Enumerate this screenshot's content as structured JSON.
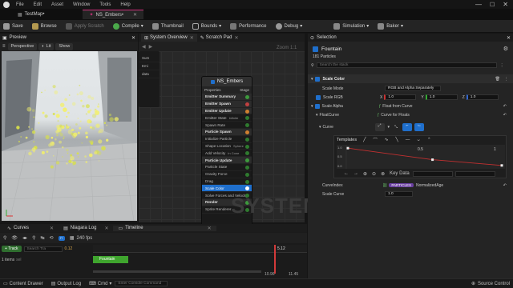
{
  "menu": [
    "File",
    "Edit",
    "Asset",
    "Window",
    "Tools",
    "Help"
  ],
  "tabs": [
    {
      "label": "TestMap•"
    },
    {
      "label": "NS_Embers•"
    }
  ],
  "toolbar": {
    "save": "Save",
    "browse": "Browse",
    "apply_scratch": "Apply Scratch",
    "compile": "Compile",
    "thumbnail": "Thumbnail",
    "bounds": "Bounds",
    "performance": "Performance",
    "debug": "Debug",
    "simulation": "Simulation",
    "baker": "Baker"
  },
  "preview": {
    "title": "Preview",
    "perspective": "Perspective",
    "lit": "Lit",
    "show": "Show"
  },
  "graph": {
    "tab_overview": "System Overview",
    "tab_scratch": "Scratch Pad",
    "zoom": "Zoom 1:1",
    "watermark": "SYSTEM",
    "emitter_name": "NS_Embers",
    "emitter_header_left": "Properties",
    "emitter_header_right": "Stage",
    "rows": [
      {
        "label": "Emitter Summary",
        "kind": "head"
      },
      {
        "label": "Emitter Spawn",
        "kind": "head"
      },
      {
        "label": "Emitter Update",
        "kind": "head"
      },
      {
        "label": "Emitter State",
        "kind": "row",
        "extra": "Infinite"
      },
      {
        "label": "Spawn Rate",
        "kind": "row"
      },
      {
        "label": "Particle Spawn",
        "kind": "head"
      },
      {
        "label": "Initialize Particle",
        "kind": "row"
      },
      {
        "label": "Shape Location",
        "kind": "row",
        "extra": "Sphere"
      },
      {
        "label": "Add Velocity",
        "kind": "row",
        "extra": "In Cone"
      },
      {
        "label": "Particle Update",
        "kind": "head"
      },
      {
        "label": "Particle State",
        "kind": "row"
      },
      {
        "label": "Gravity Force",
        "kind": "row"
      },
      {
        "label": "Drag",
        "kind": "row"
      },
      {
        "label": "Scale Color",
        "kind": "row",
        "selected": true
      },
      {
        "label": "Solve Forces and Velocity",
        "kind": "row"
      },
      {
        "label": "Render",
        "kind": "head"
      },
      {
        "label": "Sprite Renderer",
        "kind": "row"
      }
    ],
    "side_items": [
      "Sum",
      "Emi",
      "data"
    ]
  },
  "selection": {
    "title": "Selection",
    "name": "Fountain",
    "particles": "181 Particles",
    "search_placeholder": "Search the stack",
    "module": "Scale Color",
    "scale_mode_label": "Scale Mode",
    "scale_mode_value": "RGB and Alpha Separately",
    "scale_rgb_label": "Scale RGB",
    "x_label": "X",
    "x_val": "1.0",
    "y_label": "Y",
    "y_val": "1.0",
    "z_label": "Z",
    "z_val": "1.0",
    "scale_alpha_label": "Scale Alpha",
    "scale_alpha_value": "Float from Curve",
    "float_curve_label": "FloatCurve",
    "float_curve_value": "Curve for Floats",
    "curve_label": "Curve",
    "templates": "Templates",
    "tick_05": "0.5",
    "tick_1": "1",
    "key_data": "Key Data",
    "y_ticks": [
      "1.0",
      "0.5",
      "0.0"
    ],
    "curve_index_label": "CurveIndex",
    "curve_index_chip": "PARTICLES",
    "curve_index_value": "NormalizedAge",
    "scale_curve_label": "Scale Curve",
    "scale_curve_value": "1.0",
    "curve_points": [
      {
        "t": 0.0,
        "v": 0.95
      },
      {
        "t": 0.55,
        "v": 0.35
      },
      {
        "t": 1.0,
        "v": 0.05
      }
    ]
  },
  "timeline": {
    "tab_curves": "Curves",
    "tab_log": "Niagara Log",
    "tab_timeline": "Timeline",
    "fps": "240 fps",
    "track": "+ Track",
    "search": "Search Tra",
    "frame": "0.12",
    "items": "1 items",
    "items_sel": "sel",
    "track_name": "Fountain",
    "marker_value": "5.12",
    "t1": "10.96",
    "t2": "11.45"
  },
  "statusbar": {
    "content_drawer": "Content Drawer",
    "output_log": "Output Log",
    "cmd": "Cmd",
    "console_placeholder": "Enter Console Command",
    "source_control": "Source Control"
  },
  "colors": {
    "accent": "#1f6fcc",
    "bg": "#242424",
    "track_green": "#3fa52e",
    "curve_red": "#c23030",
    "marker_red": "#d23a3a"
  }
}
